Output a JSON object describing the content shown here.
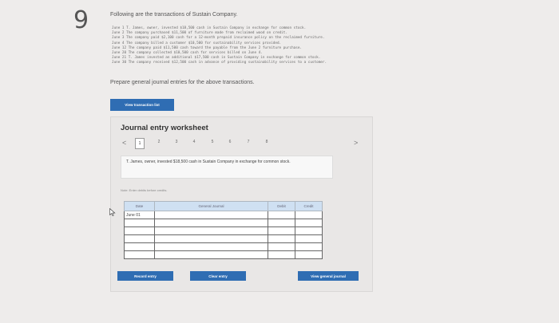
{
  "question_number": "9",
  "intro": "Following are the transactions of Sustain Company.",
  "transactions": [
    "June 1  T. James, owner, invested $18,500 cash in Sustain Company in exchange for common stock.",
    "June 2  The company purchased $11,500 of furniture made from reclaimed wood on credit.",
    "June 3  The company paid $2,100 cash for a 12-month prepaid insurance policy on the reclaimed furniture.",
    "June 4  The company billed a customer $10,500 for sustainability services provided.",
    "June 12  The company paid $11,500 cash toward the payable from the June 2 furniture purchase.",
    "June 20  The company collected $10,500 cash for services billed on June 4.",
    "June 21  T. James invested an additional $17,500 cash in Sustain Company in exchange for common stock.",
    "June 30  The company received $12,500 cash in advance of providing sustainability services to a customer."
  ],
  "prompt": "Prepare general journal entries for the above transactions.",
  "view_transaction_list_label": "View transaction list",
  "worksheet": {
    "title": "Journal entry worksheet",
    "prev_symbol": "<",
    "next_symbol": ">",
    "pages": [
      "1",
      "2",
      "3",
      "4",
      "5",
      "6",
      "7",
      "8"
    ],
    "active_page": "1",
    "description": "T. James, owner, invested $18,500 cash in Sustain Company in exchange for common stock.",
    "note": "Note: Enter debits before credits.",
    "columns": {
      "date": "Date",
      "account": "General Journal",
      "debit": "Debit",
      "credit": "Credit"
    },
    "rows": [
      {
        "date": "June 01",
        "account": "",
        "debit": "",
        "credit": ""
      },
      {
        "date": "",
        "account": "",
        "debit": "",
        "credit": ""
      },
      {
        "date": "",
        "account": "",
        "debit": "",
        "credit": ""
      },
      {
        "date": "",
        "account": "",
        "debit": "",
        "credit": ""
      },
      {
        "date": "",
        "account": "",
        "debit": "",
        "credit": ""
      },
      {
        "date": "",
        "account": "",
        "debit": "",
        "credit": ""
      }
    ],
    "record_entry_label": "Record entry",
    "clear_entry_label": "Clear entry",
    "view_general_journal_label": "View general journal"
  },
  "accent_color": "#2f6db3",
  "header_color": "#cfe0f2"
}
